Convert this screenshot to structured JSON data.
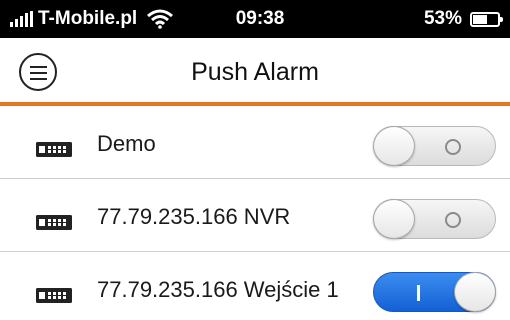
{
  "status_bar": {
    "carrier": "T-Mobile.pl",
    "time": "09:38",
    "battery": "53%",
    "battery_level": 0.53
  },
  "header": {
    "title": "Push Alarm",
    "menu_icon": "hamburger-menu-icon",
    "accent_color": "#e07a22"
  },
  "devices": [
    {
      "label": "Demo",
      "icon": "recorder-device-icon",
      "alarm_enabled": false
    },
    {
      "label": "77.79.235.166 NVR",
      "icon": "recorder-device-icon",
      "alarm_enabled": false
    },
    {
      "label": "77.79.235.166 Wejście 1",
      "icon": "recorder-device-icon",
      "alarm_enabled": true
    }
  ],
  "toggle_on_color": "#1560d4"
}
